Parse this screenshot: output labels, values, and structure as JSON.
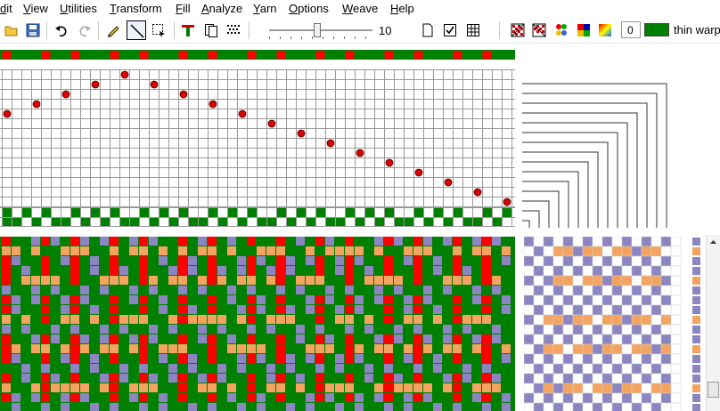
{
  "menubar": {
    "items": [
      {
        "label": "dit"
      },
      {
        "label": "View"
      },
      {
        "label": "Utilities"
      },
      {
        "label": "Transform"
      },
      {
        "label": "Fill"
      },
      {
        "label": "Analyze"
      },
      {
        "label": "Yarn"
      },
      {
        "label": "Options"
      },
      {
        "label": "Weave"
      },
      {
        "label": "Help"
      }
    ]
  },
  "toolbar": {
    "zoom": {
      "value": "10",
      "level": 0.45
    },
    "count": "0",
    "current_yarn": {
      "label": "thin warp",
      "color": "#008000"
    },
    "icons": [
      "open-icon",
      "save-icon",
      "undo-icon",
      "redo-icon",
      "pencil-icon",
      "line-icon",
      "select-icon",
      "tieup-icon",
      "copy-icon",
      "dots-icon",
      "new-icon",
      "check-icon",
      "grid-icon",
      "pattern-a-icon",
      "pattern-b-icon",
      "colors-icon",
      "palette-icon",
      "gradient-icon"
    ]
  },
  "colors": {
    "green": "#008000",
    "red": "#ff0000",
    "orange": "#f4a460",
    "purple": "#8b85c1",
    "dot": "#dd0000",
    "grid": "#999999"
  },
  "warp_colors": "RGGGRGGRGGGRGGRGGGRGGRGGGRGGRGGGRGGRGGGRGGRGGGRGGRGG",
  "tieup_dots": [
    [
      0,
      4
    ],
    [
      3,
      3
    ],
    [
      6,
      2
    ],
    [
      9,
      1
    ],
    [
      12,
      0
    ],
    [
      15,
      1
    ],
    [
      18,
      2
    ],
    [
      21,
      3
    ],
    [
      24,
      4
    ],
    [
      27,
      5
    ],
    [
      30,
      6
    ],
    [
      33,
      7
    ],
    [
      36,
      8
    ],
    [
      39,
      9
    ],
    [
      42,
      10
    ],
    [
      45,
      11
    ],
    [
      48,
      12
    ],
    [
      51,
      13
    ]
  ],
  "treadling_row1": [
    0,
    2,
    4,
    7,
    9,
    11,
    14,
    16,
    18,
    21,
    23,
    25,
    28,
    30,
    32,
    35,
    37,
    39,
    42,
    44,
    46,
    49,
    51
  ],
  "treadling_row2": [
    0,
    1,
    3,
    5,
    6,
    8,
    10,
    12,
    13,
    15,
    17,
    19,
    20,
    22,
    24,
    26,
    27,
    29,
    31,
    33,
    34,
    36,
    38,
    40,
    41,
    43,
    45,
    47,
    48,
    50
  ],
  "weft_colors": "POPPOPPPOPPOPPPOP"
}
